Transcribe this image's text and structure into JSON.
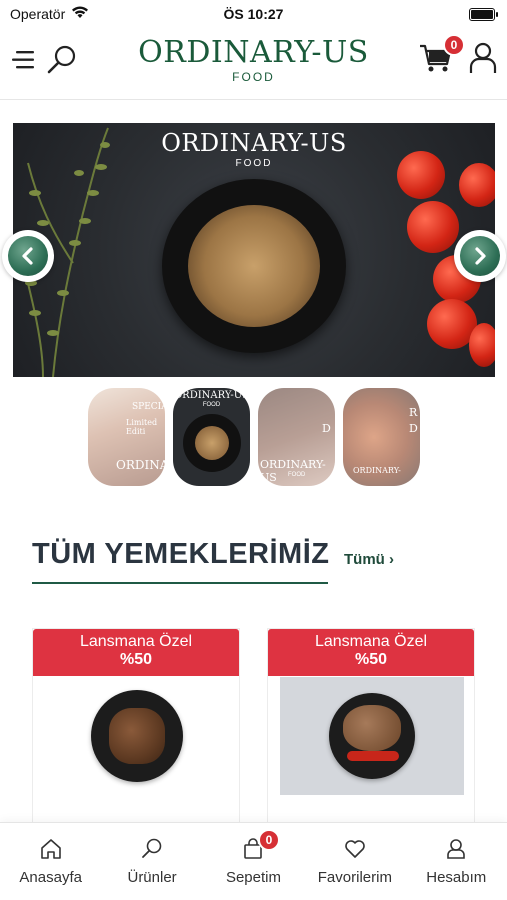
{
  "status_bar": {
    "carrier": "Operatör",
    "time": "ÖS 10:27"
  },
  "header": {
    "brand_name": "ORDINARY-US",
    "brand_sub": "FOOD",
    "cart_count": "0",
    "icons": [
      "menu-icon",
      "search-icon",
      "cart-icon",
      "user-icon"
    ]
  },
  "carousel": {
    "banner_brand": "ORDINARY-US",
    "banner_sub": "FOOD",
    "thumbnails": [
      {
        "line1": "SPECIAL",
        "line2": "Limited Editi",
        "line3": "ORDINA"
      },
      {
        "line1": "ORDINARY-US",
        "line2": "FOOD"
      },
      {
        "line1": "D",
        "line2": "ORDINARY-US",
        "line3": "FOOD"
      },
      {
        "line1": "R",
        "line2": "D",
        "line3": "ORDINARY-"
      }
    ]
  },
  "section": {
    "title": "TÜM YEMEKLERİMİZ",
    "see_all": "Tümü ›"
  },
  "products": [
    {
      "promo": "Lansmana Özel",
      "discount": "%50"
    },
    {
      "promo": "Lansmana Özel",
      "discount": "%50"
    }
  ],
  "tabbar": {
    "items": [
      {
        "label": "Anasayfa",
        "icon": "home-icon"
      },
      {
        "label": "Ürünler",
        "icon": "search-icon"
      },
      {
        "label": "Sepetim",
        "icon": "bag-icon",
        "badge": "0"
      },
      {
        "label": "Favorilerim",
        "icon": "heart-icon"
      },
      {
        "label": "Hesabım",
        "icon": "user-icon"
      }
    ]
  },
  "colors": {
    "brand_green": "#1a5a3a",
    "promo_red": "#de3341",
    "badge_red": "#d62f35",
    "title_dark": "#2b3540"
  }
}
